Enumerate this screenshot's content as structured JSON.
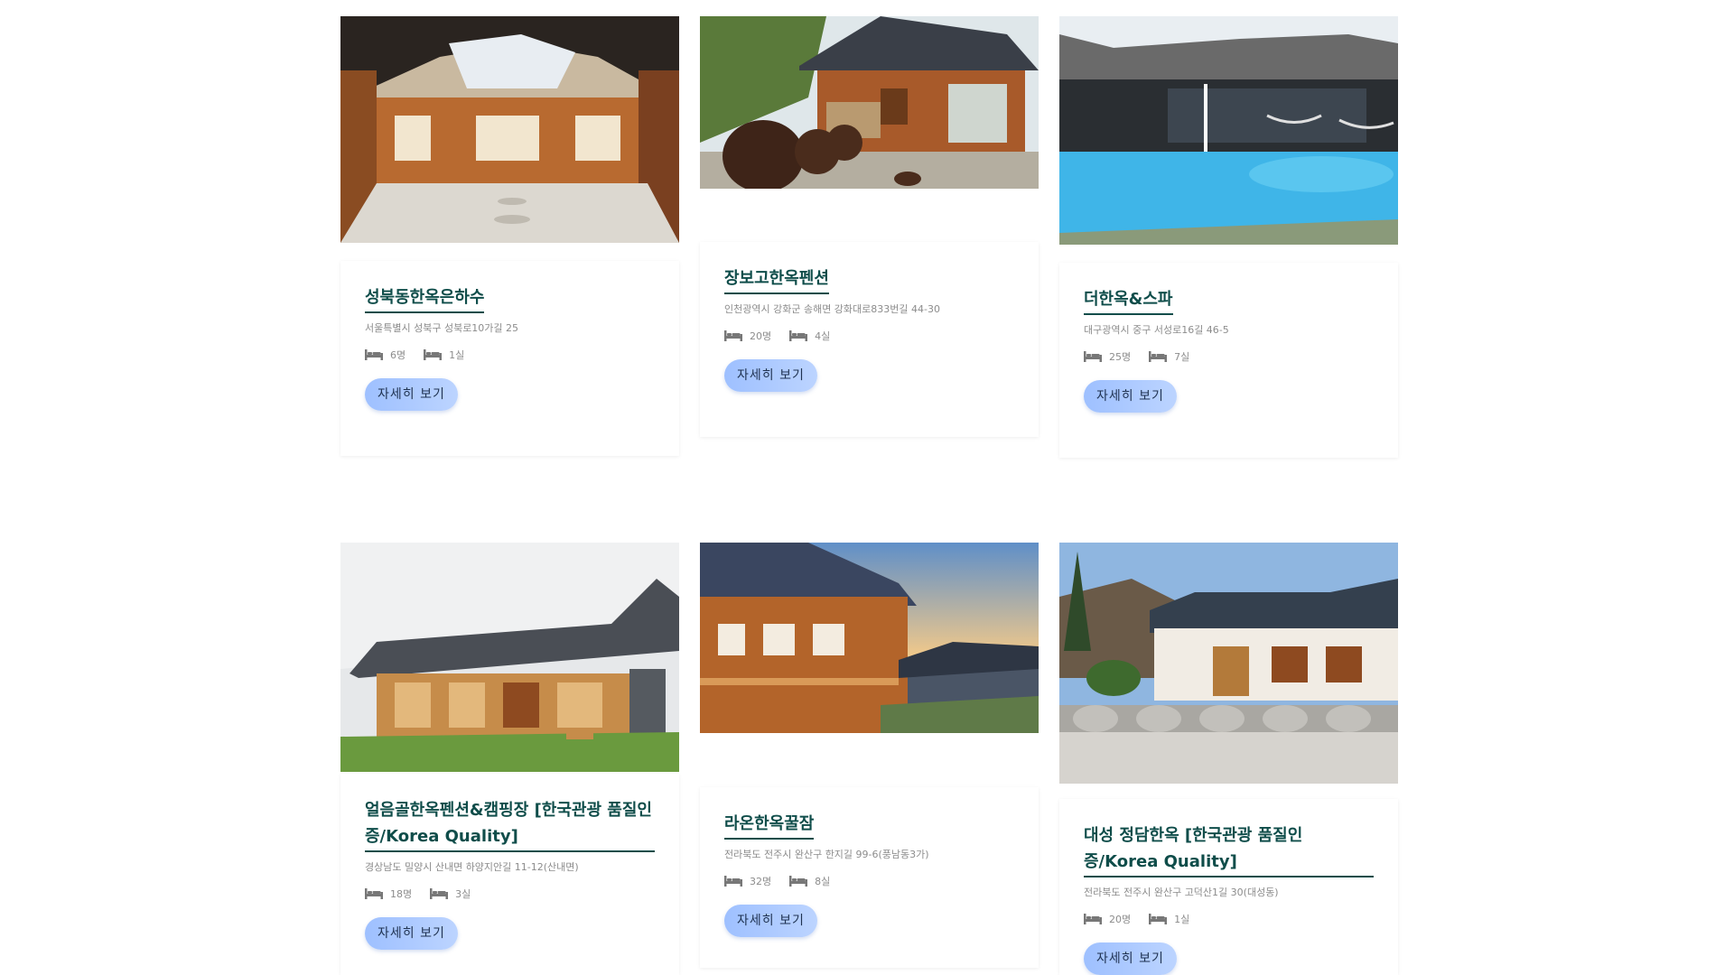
{
  "labels": {
    "detail_button": "자세히 보기"
  },
  "cards": [
    {
      "title": "성북동한옥은하수",
      "address": "서울특별시 성북구 성북로10가길 25",
      "guests": "6명",
      "rooms": "1실",
      "image": "hanok-courtyard-photo"
    },
    {
      "title": "장보고한옥펜션",
      "address": "인천광역시 강화군 송해면 강화대로833번길 44-30",
      "guests": "20명",
      "rooms": "4실",
      "image": "hanok-with-jars-photo"
    },
    {
      "title": "더한옥&스파",
      "address": "대구광역시 중구 서성로16길 46-5",
      "guests": "25명",
      "rooms": "7실",
      "image": "hanok-pool-photo"
    },
    {
      "title": "얼음골한옥펜션&캠핑장 [한국관광 품질인증/Korea Quality]",
      "address": "경상남도 밀양시 산내면 하양지안길 11-12(산내면)",
      "guests": "18명",
      "rooms": "3실",
      "image": "hanok-lawn-photo"
    },
    {
      "title": "라온한옥꿀잠",
      "address": "전라북도 전주시 완산구 한지길 99-6(풍남동3가)",
      "guests": "32명",
      "rooms": "8실",
      "image": "hanok-village-sunset-photo"
    },
    {
      "title": "대성 정담한옥 [한국관광 품질인증/Korea Quality]",
      "address": "전라북도 전주시 완산구 고덕산1길 30(대성동)",
      "guests": "20명",
      "rooms": "1실",
      "image": "hanok-stone-wall-photo"
    }
  ]
}
